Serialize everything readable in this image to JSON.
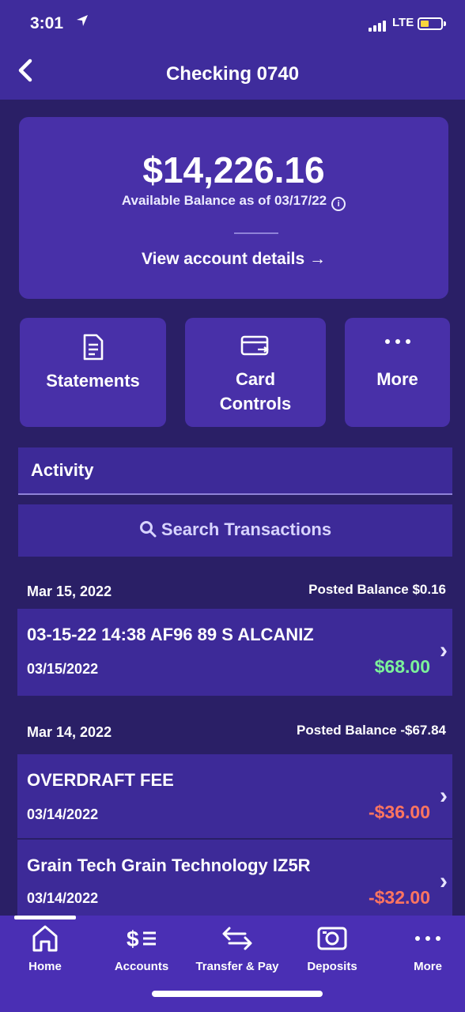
{
  "status_bar": {
    "time": "3:01",
    "network": "LTE",
    "icons": [
      "location-arrow-icon",
      "signal-bars-icon",
      "battery-icon"
    ]
  },
  "header": {
    "title": "Checking 0740",
    "back_icon": "chevron-left-icon"
  },
  "balance": {
    "amount": "$14,226.16",
    "caption": "Available Balance as of 03/17/22",
    "info_icon": "info-icon",
    "view_details": "View account details →"
  },
  "actions": [
    {
      "label": "Statements",
      "icon": "document-icon"
    },
    {
      "label_line1": "Card",
      "label_line2": "Controls",
      "icon": "card-icon"
    },
    {
      "label": "More",
      "icon": "dots-icon"
    }
  ],
  "activity": {
    "title": "Activity",
    "search_placeholder": "Search Transactions",
    "groups": [
      {
        "date": "Mar 15, 2022",
        "posted_balance": "Posted Balance $0.16",
        "transactions": [
          {
            "description": "03-15-22 14:38 AF96 89 S ALCANIZ",
            "date": "03/15/2022",
            "amount": "$68.00",
            "color": "#7cf29a"
          }
        ]
      },
      {
        "date": "Mar 14, 2022",
        "posted_balance": "Posted Balance -$67.84",
        "transactions": [
          {
            "description": "OVERDRAFT FEE",
            "date": "03/14/2022",
            "amount": "-$36.00",
            "color": "#ff7560"
          },
          {
            "description": "Grain Tech Grain Technology IZ5R",
            "date": "03/14/2022",
            "amount": "-$32.00",
            "color": "#ff7560"
          }
        ]
      }
    ]
  },
  "bottom_nav": {
    "items": [
      {
        "label": "Home",
        "icon": "home-icon",
        "active": true
      },
      {
        "label": "Accounts",
        "icon": "accounts-icon"
      },
      {
        "label": "Transfer & Pay",
        "icon": "transfer-arrows-icon"
      },
      {
        "label": "Deposits",
        "icon": "camera-deposit-icon"
      },
      {
        "label": "More",
        "icon": "dots-icon"
      }
    ]
  },
  "colors": {
    "background": "#2a1f66",
    "header": "#3f2c9c",
    "card": "#4830a8",
    "nav": "#4a2fb4",
    "positive_amount": "#7cf29a",
    "negative_amount": "#ff7560"
  }
}
